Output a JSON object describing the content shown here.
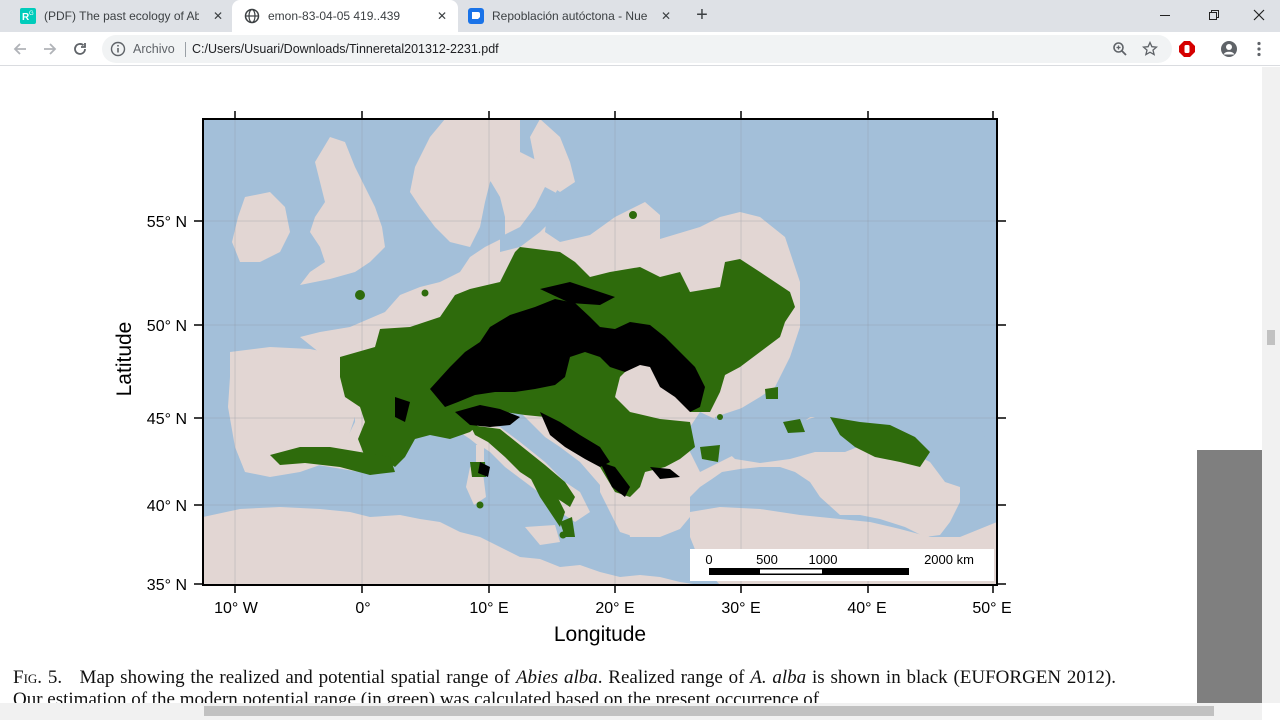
{
  "browser": {
    "tabs": [
      {
        "title": "(PDF) The past ecology of Abies alba",
        "active": false,
        "icon": "researchgate-icon"
      },
      {
        "title": "emon-83-04-05 419..439",
        "active": true,
        "icon": "globe-icon"
      },
      {
        "title": "Repoblación autóctona - Nueva entrada",
        "active": false,
        "icon": "blogger-icon"
      }
    ],
    "new_tab_symbol": "+",
    "close_symbol": "✕",
    "window_controls": [
      "minimize-icon",
      "maximize-icon",
      "close-icon"
    ]
  },
  "toolbar": {
    "site_label": "Archivo",
    "url": "C:/Users/Usuari/Downloads/Tinneretal201312-2231.pdf",
    "icons": [
      "back-icon",
      "forward-icon",
      "reload-icon",
      "info-icon",
      "zoom-icon",
      "star-icon",
      "adblock-icon",
      "profile-icon",
      "menu-icon"
    ]
  },
  "figure": {
    "lat_labels": [
      "55° N",
      "50° N",
      "45° N",
      "40° N",
      "35° N"
    ],
    "lon_labels": [
      "10° W",
      "0°",
      "10° E",
      "20° E",
      "30° E",
      "40° E",
      "50° E"
    ],
    "ylabel": "Latitude",
    "xlabel": "Longitude",
    "scalebar": [
      "0",
      "500",
      "1000",
      "2000 km"
    ],
    "colors": {
      "sea": "#a3bfd9",
      "land": "#e2d6d3",
      "potential": "#2e6b0c",
      "realized": "#000000"
    }
  },
  "caption": {
    "fig_label": "Fig. 5.",
    "text_1": "Map showing the realized and potential spatial range of ",
    "species": "Abies alba",
    "text_2": ". Realized range of ",
    "species_short": "A. alba",
    "text_3": " is shown in black (EUFORGEN 2012). Our estimation of the modern potential range (in green) was calculated based on the present occurrence of"
  }
}
